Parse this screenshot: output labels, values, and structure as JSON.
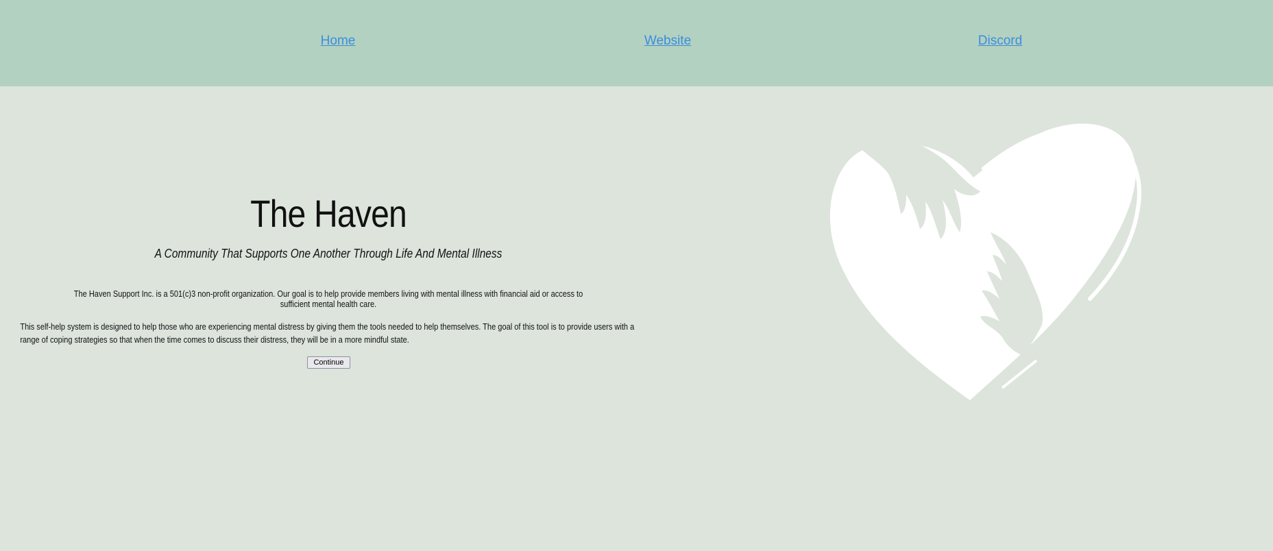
{
  "nav": {
    "home": "Home",
    "website": "Website",
    "discord": "Discord"
  },
  "hero": {
    "title": "The Haven",
    "subtitle": "A Community That Supports One Another Through Life And Mental Illness",
    "paragraph1": "The Haven Support Inc. is a 501(c)3 non-profit organization. Our goal is to help provide members living with mental illness with financial aid or access to sufficient mental health care.",
    "paragraph2": "This self-help system is designed to help those who are experiencing mental distress by giving them the tools needed to help themselves. The goal of this tool is to provide users with a range of coping strategies so that when the time comes to discuss their distress, they will be in a more mindful state.",
    "continue_label": "Continue"
  },
  "colors": {
    "nav_background": "#b3d1c0",
    "page_background": "#dce4dc",
    "link": "#3a8dde",
    "logo_fill": "#ffffff"
  },
  "logo": {
    "icon": "heart-hands-icon"
  }
}
